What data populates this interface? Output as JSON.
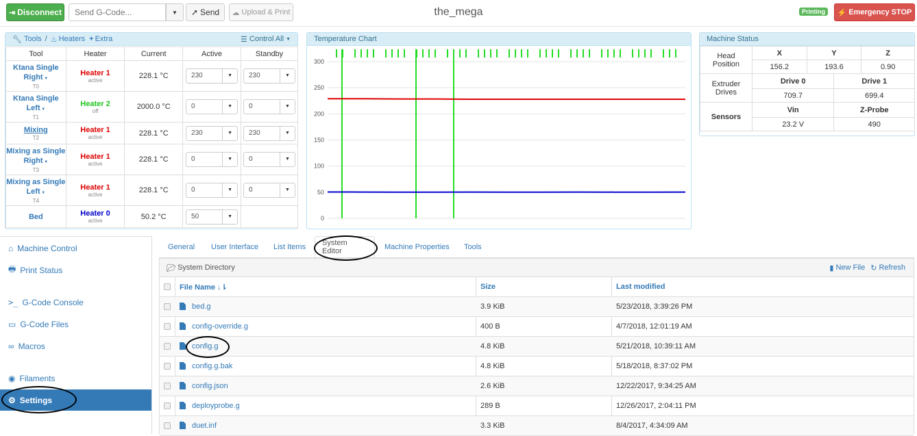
{
  "topbar": {
    "disconnect": "Disconnect",
    "gcode_placeholder": "Send G-Code...",
    "send": "Send",
    "upload_print": "Upload & Print",
    "title": "the_mega",
    "status_badge": "Printing",
    "emergency": "Emergency STOP"
  },
  "tools_panel": {
    "tab_tools": "Tools",
    "sep": "/",
    "tab_heaters": "Heaters",
    "tab_extra": "Extra",
    "control_all": "Control All",
    "headers": [
      "Tool",
      "Heater",
      "Current",
      "Active",
      "Standby"
    ],
    "rows": [
      {
        "name": "Ktana Single Right",
        "sub": "T0",
        "heater": "Heater 1",
        "heater_color": "#e00000",
        "state": "active",
        "current": "228.1 °C",
        "active": "230",
        "standby": "230"
      },
      {
        "name": "Ktana Single Left",
        "sub": "T1",
        "heater": "Heater 2",
        "heater_color": "#1fc41f",
        "state": "off",
        "current": "2000.0 °C",
        "active": "0",
        "standby": "0"
      },
      {
        "name": "Mixing",
        "sub": "T2",
        "heater": "Heater 1",
        "heater_color": "#e00000",
        "state": "active",
        "current": "228.1 °C",
        "active": "230",
        "standby": "230"
      },
      {
        "name": "Mixing as Single Right",
        "sub": "T3",
        "heater": "Heater 1",
        "heater_color": "#e00000",
        "state": "active",
        "current": "228.1 °C",
        "active": "0",
        "standby": "0"
      },
      {
        "name": "Mixing as Single Left",
        "sub": "T4",
        "heater": "Heater 1",
        "heater_color": "#e00000",
        "state": "active",
        "current": "228.1 °C",
        "active": "0",
        "standby": "0"
      },
      {
        "name": "Bed",
        "sub": "",
        "heater": "Heater 0",
        "heater_color": "#0000cc",
        "state": "active",
        "current": "50.2 °C",
        "active": "50",
        "standby": ""
      }
    ]
  },
  "temp_chart": {
    "title": "Temperature Chart",
    "chart_data": {
      "type": "line",
      "ylim": [
        0,
        300
      ],
      "yticks": [
        0,
        50,
        100,
        150,
        200,
        250,
        300
      ],
      "series": [
        {
          "color": "#e00000",
          "values": [
            229,
            229,
            228.5,
            228.5,
            228,
            228,
            228,
            228,
            228,
            228,
            228
          ]
        },
        {
          "color": "#0000cc",
          "values": [
            50.5,
            50.3,
            50.2,
            50.2,
            50.3,
            50.2,
            50.2,
            50.3,
            50.2,
            50.2,
            50.3
          ]
        }
      ],
      "grid": true,
      "legend": "none"
    }
  },
  "machine_status": {
    "title": "Machine Status",
    "head_position_label": "Head Position",
    "axes": [
      "X",
      "Y",
      "Z"
    ],
    "positions": [
      "156.2",
      "193.6",
      "0.90"
    ],
    "extruder_label": "Extruder Drives",
    "drives": [
      "Drive 0",
      "Drive 1"
    ],
    "drive_values": [
      "709.7",
      "699.4"
    ],
    "sensors_label": "Sensors",
    "sensor_names": [
      "Vin",
      "Z-Probe"
    ],
    "sensor_values": [
      "23.2 V",
      "490"
    ]
  },
  "sidebar": {
    "items": [
      {
        "label": "Machine Control",
        "icon": "home-icon"
      },
      {
        "label": "Print Status",
        "icon": "printer-icon"
      },
      {
        "label": "G-Code Console",
        "icon": "console-icon"
      },
      {
        "label": "G-Code Files",
        "icon": "hdd-icon"
      },
      {
        "label": "Macros",
        "icon": "link-icon"
      },
      {
        "label": "Filaments",
        "icon": "disc-icon"
      },
      {
        "label": "Settings",
        "icon": "gear-icon"
      }
    ]
  },
  "settings_tabs": [
    "General",
    "User Interface",
    "List Items",
    "System Editor",
    "Machine Properties",
    "Tools"
  ],
  "file_browser": {
    "directory_label": "System Directory",
    "new_file": "New File",
    "refresh": "Refresh",
    "col_name": "File Name",
    "col_size": "Size",
    "col_modified": "Last modified",
    "files": [
      {
        "name": "bed.g",
        "size": "3.9 KiB",
        "modified": "5/23/2018, 3:39:26 PM"
      },
      {
        "name": "config-override.g",
        "size": "400 B",
        "modified": "4/7/2018, 12:01:19 AM"
      },
      {
        "name": "config.g",
        "size": "4.8 KiB",
        "modified": "5/21/2018, 10:39:11 AM"
      },
      {
        "name": "config.g.bak",
        "size": "4.8 KiB",
        "modified": "5/18/2018, 8:37:02 PM"
      },
      {
        "name": "config.json",
        "size": "2.6 KiB",
        "modified": "12/22/2017, 9:34:25 AM"
      },
      {
        "name": "deployprobe.g",
        "size": "289 B",
        "modified": "12/26/2017, 2:04:11 PM"
      },
      {
        "name": "duet.inf",
        "size": "3.3 KiB",
        "modified": "8/4/2017, 4:34:09 AM"
      }
    ]
  }
}
